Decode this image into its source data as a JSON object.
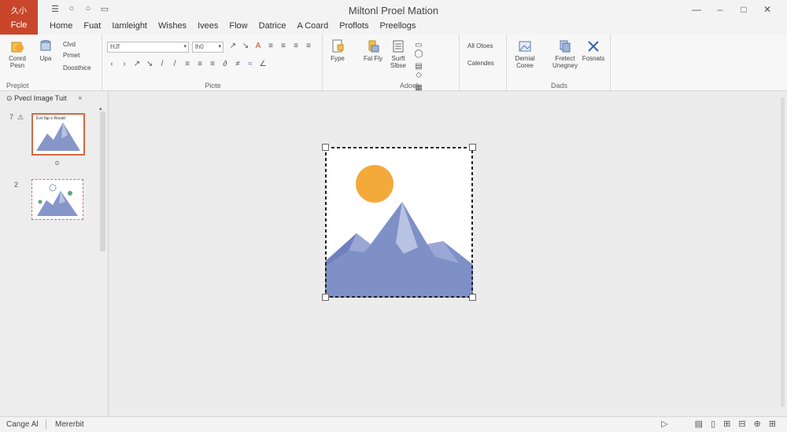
{
  "app": {
    "title": "Miltonl Proel Mation",
    "file_mark": "久小",
    "file_label": "Fcle"
  },
  "qat": [
    "☰",
    "○",
    "○",
    "▭"
  ],
  "window_controls": [
    "—",
    "–",
    "□",
    "✕"
  ],
  "tabs": [
    "Home",
    "Fuat",
    "Iamleight",
    "Wishes",
    "Ivees",
    "Flow",
    "Datrice",
    "A Coard",
    "Proflots",
    "Preellogs"
  ],
  "ribbon": {
    "clipboard": {
      "group_label": "Preplot",
      "paste_label": "Conrd Pesn",
      "upa_label": "Upa",
      "cut": "Clvd",
      "copy": "Prmet",
      "format": "Doosthice"
    },
    "font": {
      "group_label": "Piote",
      "font_name": "HJf",
      "font_size": "lh0",
      "format_row1": [
        "↗",
        "↘",
        "A",
        "≡",
        "≡",
        "≡",
        "≡",
        "≡"
      ],
      "format_row2": [
        "‹",
        "›",
        "↗",
        "↘",
        "/",
        "/",
        "≡",
        "≡",
        "≡",
        "∂",
        "≠",
        "≈",
        "∠"
      ],
      "type_label": "Fype"
    },
    "adoel": {
      "group_label": "Adoel",
      "btn1": "Fal Fly",
      "btn2": "Surft Slbse",
      "all_label": "All Otoes",
      "calendar_label": "Calendes"
    },
    "dads": {
      "group_label": "Dads",
      "btn1": "Demial Coree",
      "btn2": "Fretect Unegney",
      "btn3": "Fosnats"
    }
  },
  "left_panel": {
    "title": "Pvecl Image Tuit",
    "close": "×",
    "slides": [
      {
        "num": "7",
        "caption": "Eve fap e Rovatt"
      },
      {
        "num": "2"
      }
    ],
    "under_caption": "o"
  },
  "status": {
    "left": "Cange Al",
    "middle": "Mererbit"
  },
  "colors": {
    "accent": "#c9462b",
    "sun": "#f4a93b",
    "mountain": "#8796c9",
    "mountain_light": "#b8c2e3",
    "mountain_dark": "#6f7fbf"
  }
}
